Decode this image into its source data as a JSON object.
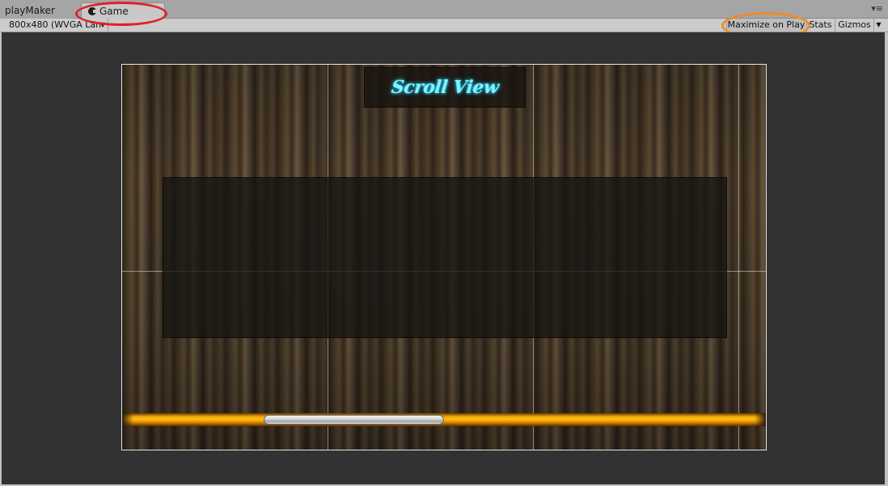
{
  "tabs": {
    "playmaker_label": "playMaker",
    "game_label": "Game",
    "menu_icon": "tab-menu-icon"
  },
  "toolbar": {
    "resolution_value": "800x480 (WVGA Lan",
    "maximize_label": "Maximize on Play",
    "stats_label": "Stats",
    "gizmos_label": "Gizmos"
  },
  "game": {
    "title_text": "Scroll View"
  },
  "scrollbar": {
    "thumb_start_fraction": 0.22,
    "thumb_size_fraction": 0.28
  },
  "colors": {
    "annotation_red": "#e0202c",
    "annotation_orange": "#f08a2a",
    "title_glow": "#7ff5ff",
    "scroll_track": "#ffc21a"
  }
}
